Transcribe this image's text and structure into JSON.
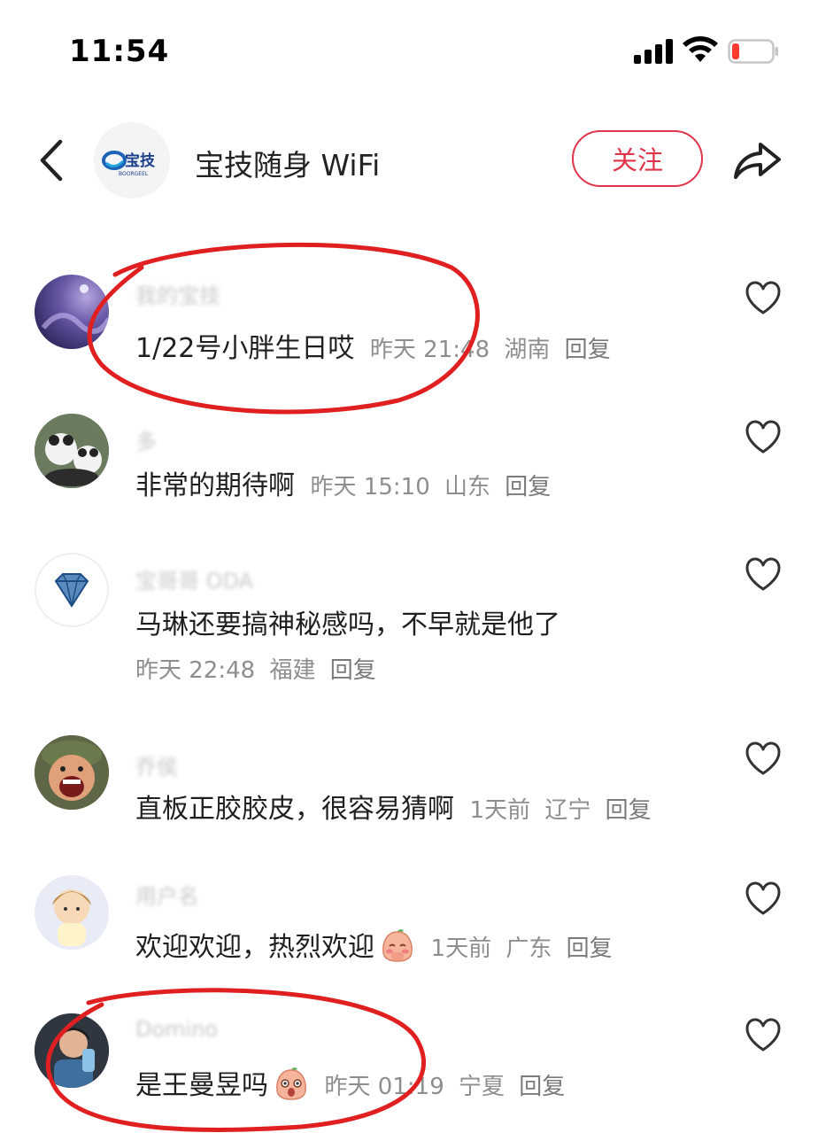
{
  "status_bar": {
    "time": "11:54"
  },
  "header": {
    "account_name": "宝技随身 WiFi",
    "logo_text": "宝技",
    "logo_subtext": "BOORGEEL",
    "follow_label": "关注"
  },
  "comments": [
    {
      "username": "我的宝技",
      "text": "1/22号小胖生日哎",
      "time": "昨天 21:48",
      "location": "湖南",
      "reply": "回复"
    },
    {
      "username": "多",
      "text": "非常的期待啊",
      "time": "昨天 15:10",
      "location": "山东",
      "reply": "回复"
    },
    {
      "username": "宝哥哥 ODA",
      "text": "马琳还要搞神秘感吗，不早就是他了",
      "time": "昨天 22:48",
      "location": "福建",
      "reply": "回复"
    },
    {
      "username": "乔侯",
      "text": "直板正胶胶皮，很容易猜啊",
      "time": "1天前",
      "location": "辽宁",
      "reply": "回复"
    },
    {
      "username": "用户名",
      "text": "欢迎欢迎，热烈欢迎",
      "time": "1天前",
      "location": "广东",
      "reply": "回复"
    },
    {
      "username": "Domino",
      "text": "是王曼昱吗",
      "time": "昨天 01:19",
      "location": "宁夏",
      "reply": "回复"
    }
  ],
  "colors": {
    "accent": "#e0344a",
    "annotation": "#e02020",
    "meta": "#8e8e8e"
  }
}
